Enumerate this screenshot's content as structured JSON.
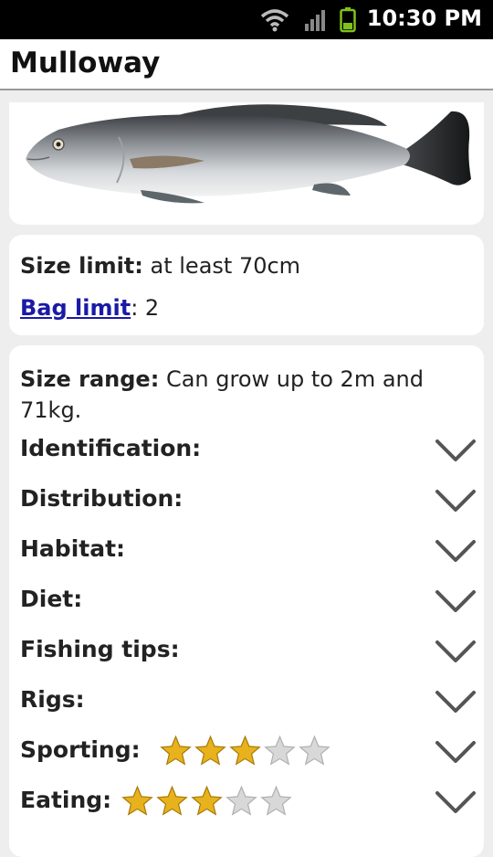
{
  "status_bar": {
    "time": "10:30 PM",
    "icons": [
      "wifi-icon",
      "signal-icon",
      "battery-icon"
    ]
  },
  "header": {
    "title": "Mulloway"
  },
  "fish_image": {
    "icon": "fish-image"
  },
  "limits": {
    "size_limit_label": "Size limit:",
    "size_limit_value": "at least 70cm",
    "bag_limit_label": "Bag limit",
    "bag_limit_value": ": 2"
  },
  "details": {
    "size_range_label": "Size range:",
    "size_range_value_line1": "Can grow up to 2m and",
    "size_range_value_line2": "71kg.",
    "sections": [
      {
        "label": "Identification:"
      },
      {
        "label": "Distribution:"
      },
      {
        "label": "Habitat:"
      },
      {
        "label": "Diet:"
      },
      {
        "label": "Fishing tips:"
      },
      {
        "label": "Rigs:"
      },
      {
        "label": "Sporting:",
        "rating": 3,
        "max": 5
      },
      {
        "label": "Eating:",
        "rating": 3,
        "max": 5
      }
    ]
  },
  "colors": {
    "link": "#1a1aa6",
    "star_gold": "#e8b21c",
    "star_empty": "#d8d8d8"
  }
}
